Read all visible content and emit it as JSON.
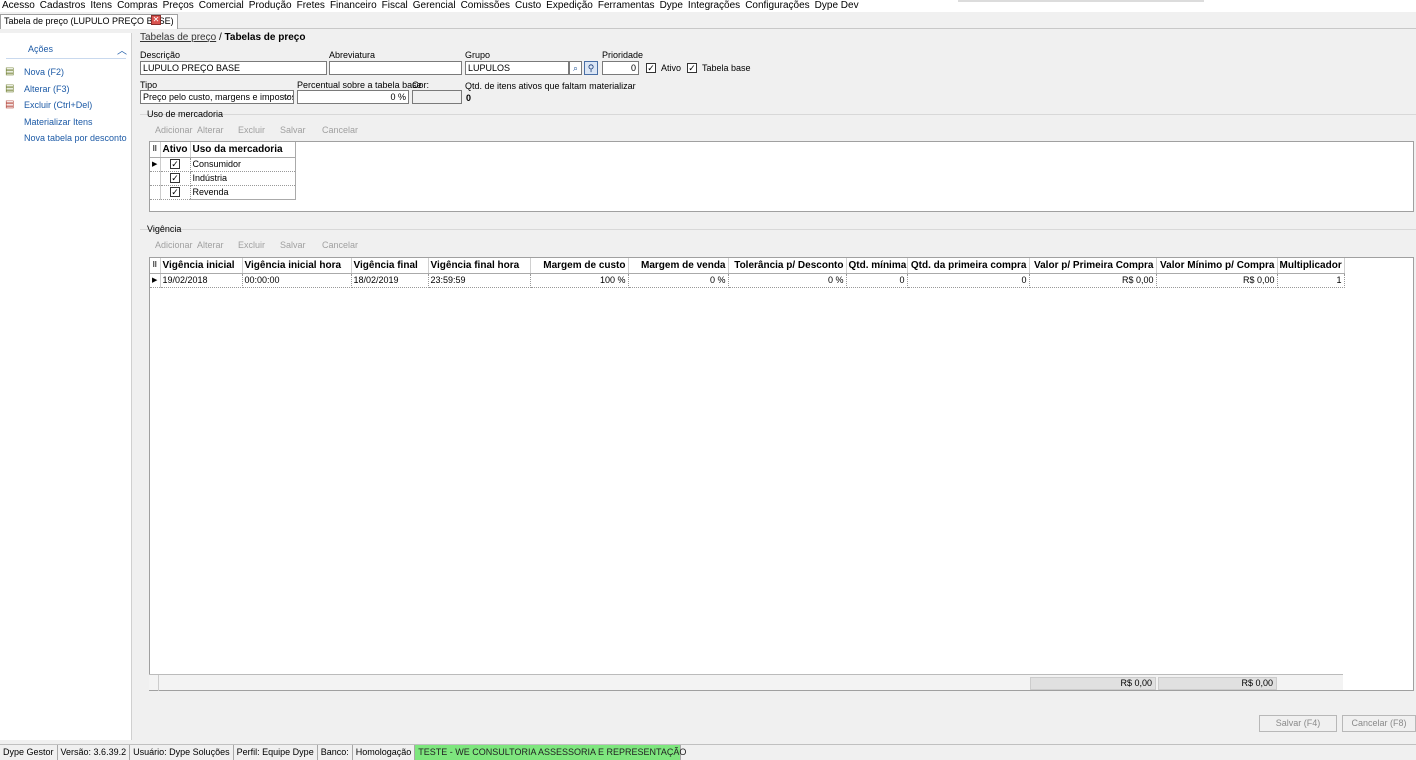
{
  "menu": [
    "Acesso",
    "Cadastros",
    "Itens",
    "Compras",
    "Preços",
    "Comercial",
    "Produção",
    "Fretes",
    "Financeiro",
    "Fiscal",
    "Gerencial",
    "Comissões",
    "Custo",
    "Expedição",
    "Ferramentas",
    "Dype",
    "Integrações",
    "Configurações",
    "Dype Dev"
  ],
  "tab": {
    "label": "Tabela de preço (LUPULO PREÇO BASE)",
    "close": "✕"
  },
  "sidebar": {
    "title": "Ações",
    "actions": [
      "Nova (F2)",
      "Alterar (F3)",
      "Excluir (Ctrl+Del)",
      "Materializar Itens",
      "Nova tabela por desconto"
    ]
  },
  "breadcrumb": {
    "link": "Tabelas de preço",
    "sep": "/",
    "current": "Tabelas de preço"
  },
  "form": {
    "descricao_label": "Descrição",
    "descricao_value": "LUPULO PREÇO BASE",
    "abreviatura_label": "Abreviatura",
    "abreviatura_value": "",
    "grupo_label": "Grupo",
    "grupo_value": "LUPULOS",
    "prioridade_label": "Prioridade",
    "prioridade_value": "0",
    "ativo_label": "Ativo",
    "ativo_checked": "✓",
    "tabela_base_label": "Tabela base",
    "tabela_base_checked": "✓",
    "tipo_label": "Tipo",
    "tipo_value": "Preço pelo custo, margens e impostos",
    "percentual_label": "Percentual sobre a tabela base",
    "percentual_value": "0 %",
    "cor_label": "Cor:",
    "qtd_label": "Qtd. de itens ativos que faltam materializar",
    "qtd_value": "0"
  },
  "uso_mercadoria": {
    "title": "Uso de mercadoria",
    "toolbar": [
      "Adicionar",
      "Alterar",
      "Excluir",
      "Salvar",
      "Cancelar"
    ],
    "headers": [
      "Ativo",
      "Uso da mercadoria"
    ],
    "rows": [
      {
        "ativo": "✓",
        "uso": "Consumidor"
      },
      {
        "ativo": "✓",
        "uso": "Indústria"
      },
      {
        "ativo": "✓",
        "uso": "Revenda"
      }
    ]
  },
  "vigencia": {
    "title": "Vigência",
    "toolbar": [
      "Adicionar",
      "Alterar",
      "Excluir",
      "Salvar",
      "Cancelar"
    ],
    "headers": [
      "Vigência inicial",
      "Vigência inicial hora",
      "Vigência final",
      "Vigência final hora",
      "Margem de custo",
      "Margem de venda",
      "Tolerância p/ Desconto",
      "Qtd. mínima",
      "Qtd. da primeira compra",
      "Valor p/ Primeira Compra",
      "Valor Mínimo p/ Compra",
      "Multiplicador"
    ],
    "row": [
      "19/02/2018",
      "00:00:00",
      "18/02/2019",
      "23:59:59",
      "100 %",
      "0 %",
      "0 %",
      "0",
      "0",
      "R$ 0,00",
      "R$ 0,00",
      "1"
    ],
    "totals": {
      "valor_primeira": "R$ 0,00",
      "valor_minimo": "R$ 0,00"
    }
  },
  "buttons": {
    "salvar": "Salvar (F4)",
    "cancelar": "Cancelar (F8)"
  },
  "status": [
    "Dype Gestor",
    "Versão: 3.6.39.2",
    "Usuário: Dype Soluções",
    "Perfil: Equipe Dype",
    "Banco:",
    "Homologação",
    "TESTE - WE CONSULTORIA ASSESSORIA E REPRESENTAÇÃO"
  ]
}
